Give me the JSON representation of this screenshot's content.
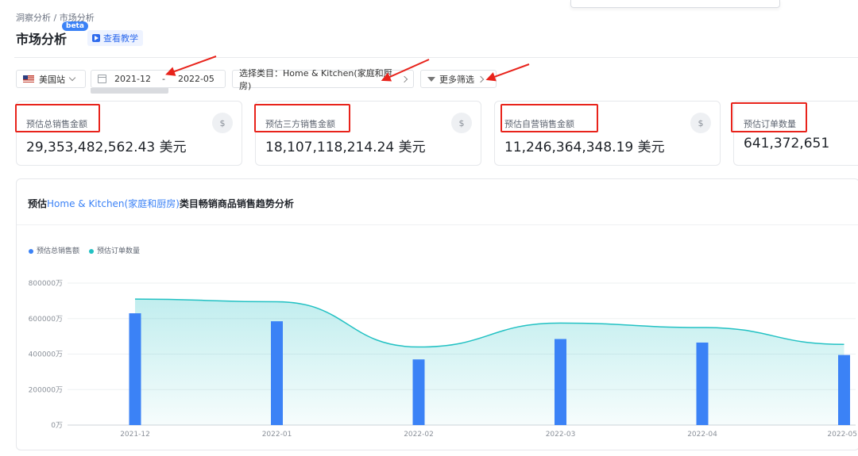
{
  "breadcrumb": "洞察分析 / 市场分析",
  "page_title": "市场分析",
  "beta_badge": "beta",
  "tutorial_label": "查看教学",
  "filters": {
    "site": "美国站",
    "date_start": "2021-12",
    "date_sep": "-",
    "date_end": "2022-05",
    "category": "选择类目：Home & Kitchen(家庭和厨房)",
    "more": "更多筛选"
  },
  "metrics": [
    {
      "label": "预估总销售金额",
      "value": "29,353,482,562.43 美元",
      "icon": "$"
    },
    {
      "label": "预估三方销售金额",
      "value": "18,107,118,214.24 美元",
      "icon": "$"
    },
    {
      "label": "预估自营销售金额",
      "value": "11,246,364,348.19 美元",
      "icon": "$"
    },
    {
      "label": "预估订单数量",
      "value": "641,372,651",
      "icon": ""
    }
  ],
  "chart_panel": {
    "title_pre": "预估",
    "title_hl": "Home & Kitchen(家庭和厨房)",
    "title_post": "类目畅销商品销售趋势分析"
  },
  "colors": {
    "accent": "#3b82f6",
    "teal": "#22c1c3",
    "annotation": "#e8231b"
  },
  "chart_data": {
    "type": "bar",
    "categories": [
      "2021-12",
      "2022-01",
      "2022-02",
      "2022-03",
      "2022-04",
      "2022-05"
    ],
    "series": [
      {
        "name": "预估总销售额",
        "type": "bar",
        "color": "#3b82f6",
        "values": [
          630000,
          585000,
          370000,
          485000,
          465000,
          395000
        ]
      },
      {
        "name": "预估订单数量",
        "type": "area",
        "color": "#22c1c3",
        "values": [
          710000,
          695000,
          440000,
          575000,
          550000,
          455000
        ]
      }
    ],
    "yticks": [
      "0万",
      "200000万",
      "400000万",
      "600000万",
      "800000万"
    ],
    "ylim": [
      0,
      800000
    ],
    "legend_position": "top-left",
    "grid": true
  }
}
